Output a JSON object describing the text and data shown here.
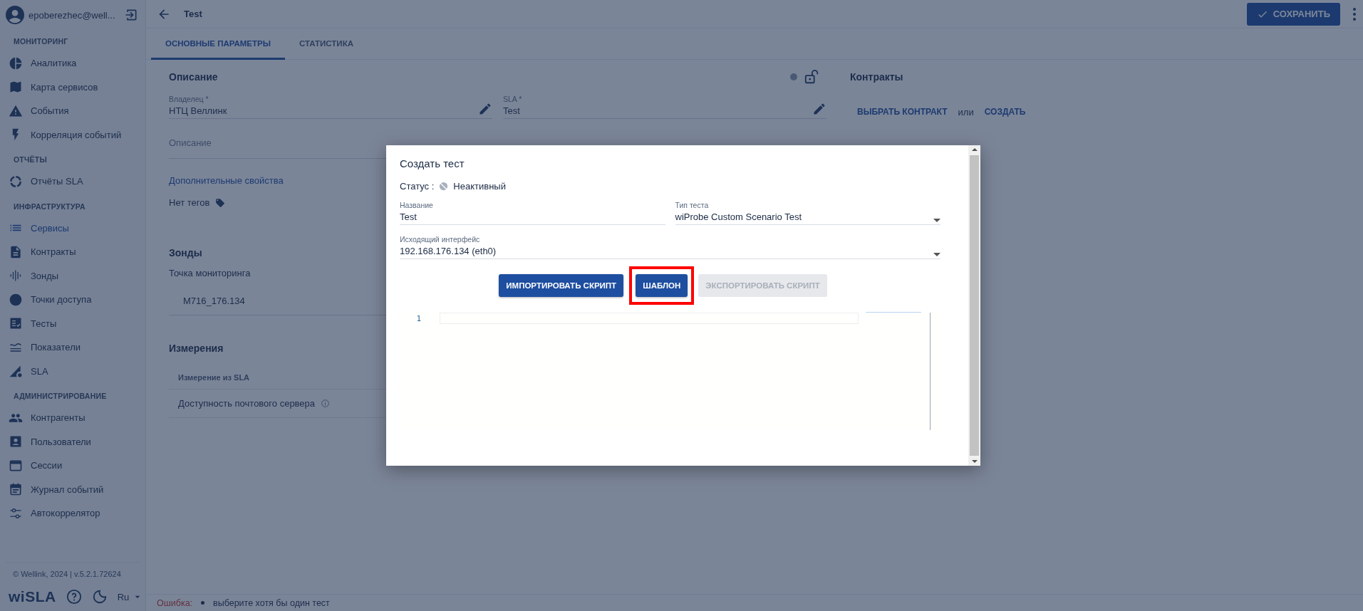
{
  "user": {
    "name": "epoberezhec@well..."
  },
  "sidebar": {
    "sections": [
      {
        "title": "МОНИТОРИНГ",
        "items": [
          {
            "label": "Аналитика",
            "selected": false
          },
          {
            "label": "Карта сервисов",
            "selected": false
          },
          {
            "label": "События",
            "selected": false
          },
          {
            "label": "Корреляция событий",
            "selected": false
          }
        ]
      },
      {
        "title": "ОТЧЁТЫ",
        "items": [
          {
            "label": "Отчёты SLA",
            "selected": false
          }
        ]
      },
      {
        "title": "ИНФРАСТРУКТУРА",
        "items": [
          {
            "label": "Сервисы",
            "selected": true
          },
          {
            "label": "Контракты",
            "selected": false
          },
          {
            "label": "Зонды",
            "selected": false
          },
          {
            "label": "Точки доступа",
            "selected": false
          },
          {
            "label": "Тесты",
            "selected": false
          },
          {
            "label": "Показатели",
            "selected": false
          },
          {
            "label": "SLA",
            "selected": false
          }
        ]
      },
      {
        "title": "АДМИНИСТРИРОВАНИЕ",
        "items": [
          {
            "label": "Контрагенты",
            "selected": false
          },
          {
            "label": "Пользователи",
            "selected": false
          },
          {
            "label": "Сессии",
            "selected": false
          },
          {
            "label": "Журнал событий",
            "selected": false
          },
          {
            "label": "Автокоррелятор",
            "selected": false
          }
        ]
      }
    ],
    "copyright": "© Wellink, 2024 | v.5.2.1.72624",
    "logo": "wiSLA",
    "language": "Ru"
  },
  "header": {
    "title": "Test",
    "save_button": "СОХРАНИТЬ"
  },
  "tabs": [
    {
      "label": "ОСНОВНЫЕ ПАРАМЕТРЫ",
      "selected": true
    },
    {
      "label": "СТАТИСТИКА",
      "selected": false
    }
  ],
  "description": {
    "heading": "Описание",
    "fields": [
      {
        "label": "Владелец *",
        "value": "НТЦ Веллинк"
      },
      {
        "label": "SLA *",
        "value": "Test"
      }
    ],
    "placeholder": "Описание",
    "extra_link": "Дополнительные свойства",
    "tags": "Нет тегов"
  },
  "probes": {
    "heading": "Зонды",
    "label": "Точка мониторинга",
    "value": "M716_176.134"
  },
  "measurements": {
    "heading": "Измерения",
    "column": "Измерение из SLA",
    "rows": [
      "Доступность почтового сервера"
    ]
  },
  "contracts": {
    "heading": "Контракты",
    "choose": "ВЫБРАТЬ КОНТРАКТ",
    "or": "или",
    "create": "СОЗДАТЬ"
  },
  "dialog": {
    "title": "Создать тест",
    "status_label": "Статус :",
    "status": "Неактивный",
    "fields": [
      {
        "label": "Название",
        "value": "Test",
        "kind": "text"
      },
      {
        "label": "Тип теста",
        "value": "wiProbe Custom Scenario Test",
        "kind": "select"
      },
      {
        "label": "Исходящий интерфейс",
        "value": "192.168.176.134 (eth0)",
        "kind": "select"
      }
    ],
    "buttons": [
      {
        "label": "ИМПОРТИРОВАТЬ СКРИПТ",
        "disabled": false,
        "highlighted": false
      },
      {
        "label": "ШАБЛОН",
        "disabled": false,
        "highlighted": true
      },
      {
        "label": "ЭКСПОРТИРОВАТЬ СКРИПТ",
        "disabled": true,
        "highlighted": false
      }
    ],
    "line_numbers": [
      "1"
    ]
  },
  "status_bar": {
    "error_label": "Ошибка:",
    "errors": [
      "выберите хотя бы один тест"
    ]
  }
}
